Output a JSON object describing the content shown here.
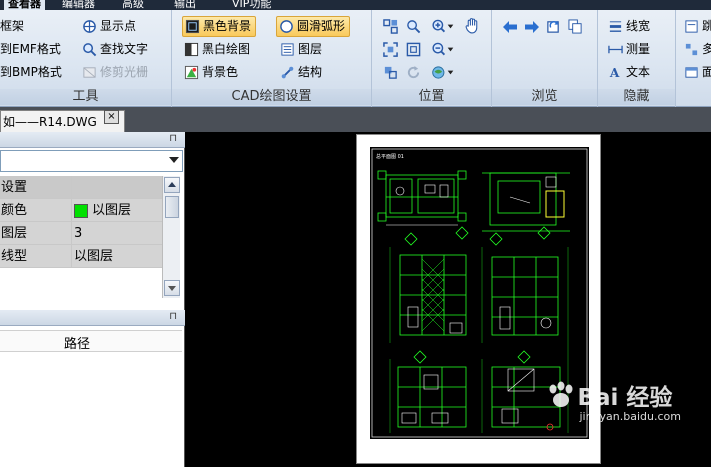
{
  "ribbon_tabs": [
    {
      "label": "查看器",
      "active": true
    },
    {
      "label": "编辑器",
      "active": false
    },
    {
      "label": "高级",
      "active": false
    },
    {
      "label": "输出",
      "active": false
    },
    {
      "label": "VIP功能",
      "active": false
    }
  ],
  "tools_group": {
    "title": "工具",
    "items": [
      "框架",
      "到EMF格式",
      "到BMP格式",
      "显示点",
      "查找文字",
      "修剪光栅"
    ]
  },
  "cad_group": {
    "title": "CAD绘图设置",
    "items": [
      "黑色背景",
      "圆滑弧形",
      "黑白绘图",
      "图层",
      "背景色",
      "结构"
    ]
  },
  "position_group": {
    "title": "位置"
  },
  "browse_group": {
    "title": "浏览"
  },
  "hide_group": {
    "title": "隐藏",
    "items": [
      "线宽",
      "测量",
      "文本"
    ]
  },
  "extra_group": {
    "items": [
      "跳",
      "多",
      "面"
    ]
  },
  "document_tab": {
    "label": "如——R14.DWG",
    "close": "×"
  },
  "properties": {
    "pin": "⊓",
    "rows": [
      {
        "name": "设置",
        "value": ""
      },
      {
        "name": "颜色",
        "value": "以图层",
        "swatch": "#00e000"
      },
      {
        "name": "图层",
        "value": "3"
      },
      {
        "name": "线型",
        "value": "以图层"
      }
    ]
  },
  "lower_panel": {
    "pin": "⊓",
    "column": "路径"
  },
  "drawing": {
    "sheet_title": "总平面图 01"
  },
  "watermark": {
    "logo": "Bai 经验",
    "url": "jingyan.baidu.com"
  }
}
